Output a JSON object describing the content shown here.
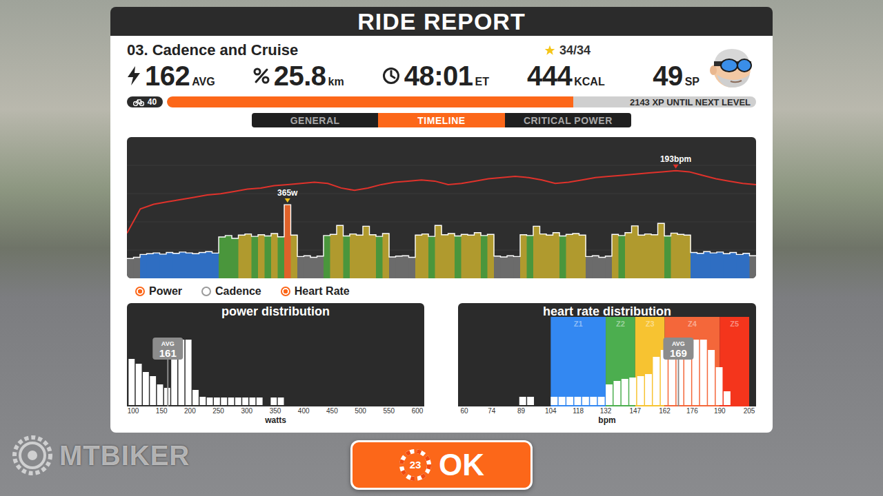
{
  "report": {
    "title": "RIDE REPORT",
    "workout": "03. Cadence and Cruise",
    "rating": "34/34"
  },
  "stats": [
    {
      "kind": "power",
      "value": "162",
      "unit": "AVG"
    },
    {
      "kind": "distance",
      "value": "25.8",
      "unit": "km"
    },
    {
      "kind": "time",
      "value": "48:01",
      "unit": "ET"
    },
    {
      "kind": "calories",
      "value": "444",
      "unit": "KCAL"
    },
    {
      "kind": "points",
      "value": "49",
      "unit": "SP"
    }
  ],
  "level": {
    "number": "40",
    "level": 0.69,
    "xp_text": "2143 XP UNTIL NEXT LEVEL"
  },
  "tabs": [
    {
      "label": "GENERAL",
      "selected": false
    },
    {
      "label": "TIMELINE",
      "selected": true
    },
    {
      "label": "CRITICAL POWER",
      "selected": false
    }
  ],
  "timeline": {
    "power_max": 700,
    "power_peak_label": "365w",
    "power_zones": [
      {
        "max": 112,
        "color": "#6b6b6b"
      },
      {
        "max": 150,
        "color": "#2f6ec2"
      },
      {
        "max": 212,
        "color": "#4a963c"
      },
      {
        "max": 280,
        "color": "#b09a2e"
      },
      {
        "max": 400,
        "color": "#e0622a"
      },
      {
        "max": 2000,
        "color": "#d8352a"
      }
    ],
    "power": [
      98,
      104,
      118,
      122,
      126,
      120,
      128,
      124,
      130,
      126,
      122,
      128,
      132,
      125,
      205,
      212,
      198,
      214,
      220,
      208,
      216,
      210,
      222,
      206,
      365,
      214,
      108,
      112,
      104,
      110,
      212,
      218,
      262,
      210,
      220,
      214,
      258,
      216,
      208,
      222,
      106,
      110,
      112,
      104,
      214,
      220,
      208,
      262,
      216,
      222,
      210,
      218,
      214,
      226,
      212,
      218,
      110,
      106,
      112,
      108,
      216,
      212,
      258,
      220,
      214,
      226,
      210,
      218,
      222,
      214,
      108,
      112,
      104,
      110,
      218,
      212,
      226,
      260,
      214,
      220,
      216,
      272,
      210,
      224,
      218,
      214,
      128,
      124,
      132,
      126,
      130,
      122,
      128,
      118,
      124,
      112
    ],
    "heart_rate_min": 100,
    "heart_rate_max": 222,
    "heart_rate_peak_label": "193bpm",
    "heart_rate": [
      139,
      160,
      164,
      166,
      168,
      170,
      172,
      173,
      175,
      177,
      178,
      180,
      181,
      182,
      183,
      182,
      178,
      176,
      178,
      181,
      183,
      184,
      185,
      184,
      181,
      182,
      184,
      186,
      187,
      188,
      187,
      185,
      182,
      183,
      185,
      187,
      188,
      189,
      190,
      191,
      192,
      193,
      192,
      189,
      186,
      184,
      182,
      181
    ]
  },
  "legend": [
    {
      "label": "Power",
      "checked": true
    },
    {
      "label": "Cadence",
      "checked": false
    },
    {
      "label": "Heart Rate",
      "checked": true
    }
  ],
  "power_distribution": {
    "title": "power distribution",
    "axis_title": "watts",
    "avg_label": "AVG",
    "avg_text": "161",
    "ticks": [
      "100",
      "150",
      "200",
      "250",
      "300",
      "350",
      "400",
      "450",
      "500",
      "550",
      "600"
    ],
    "first_bin": 92,
    "bin_width": 12.5,
    "counts": [
      67,
      60,
      48,
      42,
      30,
      25,
      88,
      95,
      95,
      22,
      12,
      11,
      11,
      11,
      11,
      11,
      11,
      11,
      11,
      0,
      11,
      11
    ]
  },
  "heart_rate_distribution": {
    "title": "heart rate distribution",
    "axis_title": "bpm",
    "avg_label": "AVG",
    "avg_text": "169",
    "ticks": [
      "60",
      "74",
      "89",
      "104",
      "118",
      "132",
      "147",
      "162",
      "176",
      "190",
      "205"
    ],
    "zones": [
      {
        "label": "Z1",
        "from": 104,
        "to": 132,
        "color": "#3388f2"
      },
      {
        "label": "Z2",
        "from": 132,
        "to": 147,
        "color": "#4cae4f"
      },
      {
        "label": "Z3",
        "from": 147,
        "to": 162,
        "color": "#f7c331"
      },
      {
        "label": "Z4",
        "from": 162,
        "to": 190,
        "color": "#f4673a"
      },
      {
        "label": "Z5",
        "from": 190,
        "to": 205,
        "color": "#f4351c"
      }
    ],
    "first_bin": 60,
    "bin_width": 4,
    "counts": [
      0,
      0,
      0,
      0,
      0,
      0,
      0,
      12,
      12,
      0,
      0,
      12,
      12,
      12,
      12,
      12,
      12,
      12,
      30,
      35,
      38,
      40,
      42,
      45,
      70,
      80,
      85,
      88,
      90,
      95,
      95,
      80,
      55,
      20,
      0,
      0
    ]
  },
  "ok_button": {
    "badge": "23",
    "label": "OK"
  },
  "watermark": {
    "text": "MTBIKER"
  }
}
